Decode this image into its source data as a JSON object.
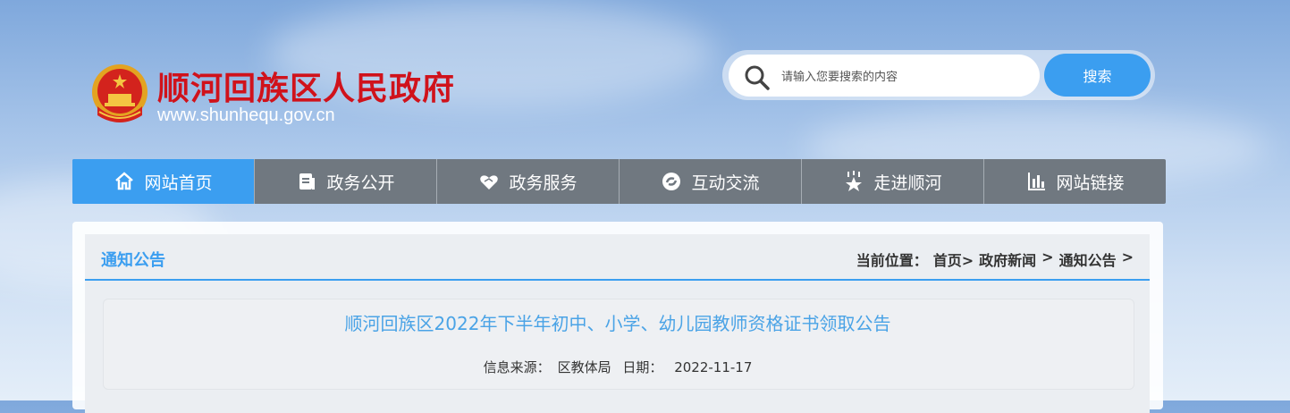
{
  "header": {
    "site_title": "顺河回族区人民政府",
    "site_url": "www.shunhequ.gov.cn"
  },
  "search": {
    "placeholder": "请输入您要搜索的内容",
    "button_label": "搜索"
  },
  "nav": {
    "items": [
      {
        "label": "网站首页",
        "icon": "home-icon",
        "active": true
      },
      {
        "label": "政务公开",
        "icon": "document-icon"
      },
      {
        "label": "政务服务",
        "icon": "handshake-icon"
      },
      {
        "label": "互动交流",
        "icon": "exchange-icon"
      },
      {
        "label": "走进顺河",
        "icon": "star-person-icon"
      },
      {
        "label": "网站链接",
        "icon": "chart-bar-icon"
      }
    ]
  },
  "section": {
    "title": "通知公告",
    "breadcrumb_prefix": "当前位置：",
    "breadcrumb": [
      "首页>",
      "政府新闻",
      ">",
      "通知公告",
      ">"
    ]
  },
  "article": {
    "title": "顺河回族区2022年下半年初中、小学、幼儿园教师资格证书领取公告",
    "source_label": "信息来源：",
    "source_value": "区教体局",
    "date_label": "日期：",
    "date_value": "2022-11-17"
  },
  "colors": {
    "accent": "#3b9ef0",
    "title_red": "#d0121b",
    "nav_gray": "#707880"
  }
}
